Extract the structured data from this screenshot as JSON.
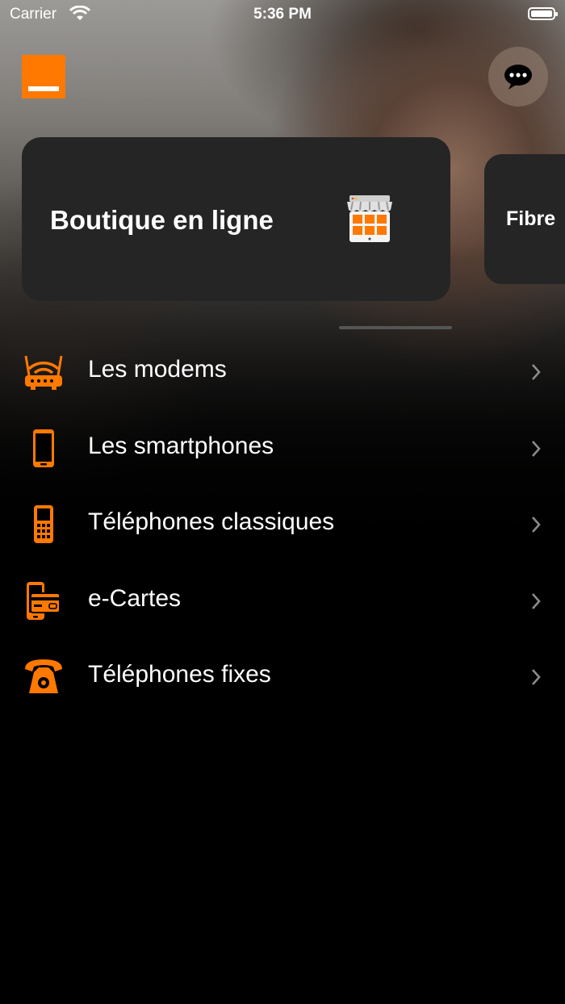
{
  "status_bar": {
    "carrier": "Carrier",
    "time": "5:36 PM"
  },
  "header": {
    "logo_icon": "orange-logo",
    "chat_icon": "chat-bubble-icon"
  },
  "cards": [
    {
      "title": "Boutique en ligne",
      "icon": "storefront-icon"
    },
    {
      "title": "Fibre"
    }
  ],
  "categories": [
    {
      "label": "Les modems",
      "icon": "modem-icon"
    },
    {
      "label": "Les smartphones",
      "icon": "smartphone-icon"
    },
    {
      "label": "Téléphones classiques",
      "icon": "feature-phone-icon"
    },
    {
      "label": "e-Cartes",
      "icon": "e-card-icon"
    },
    {
      "label": "Téléphones fixes",
      "icon": "landline-phone-icon"
    }
  ],
  "colors": {
    "accent": "#ff7900",
    "card_bg": "#252525",
    "background": "#000000"
  }
}
